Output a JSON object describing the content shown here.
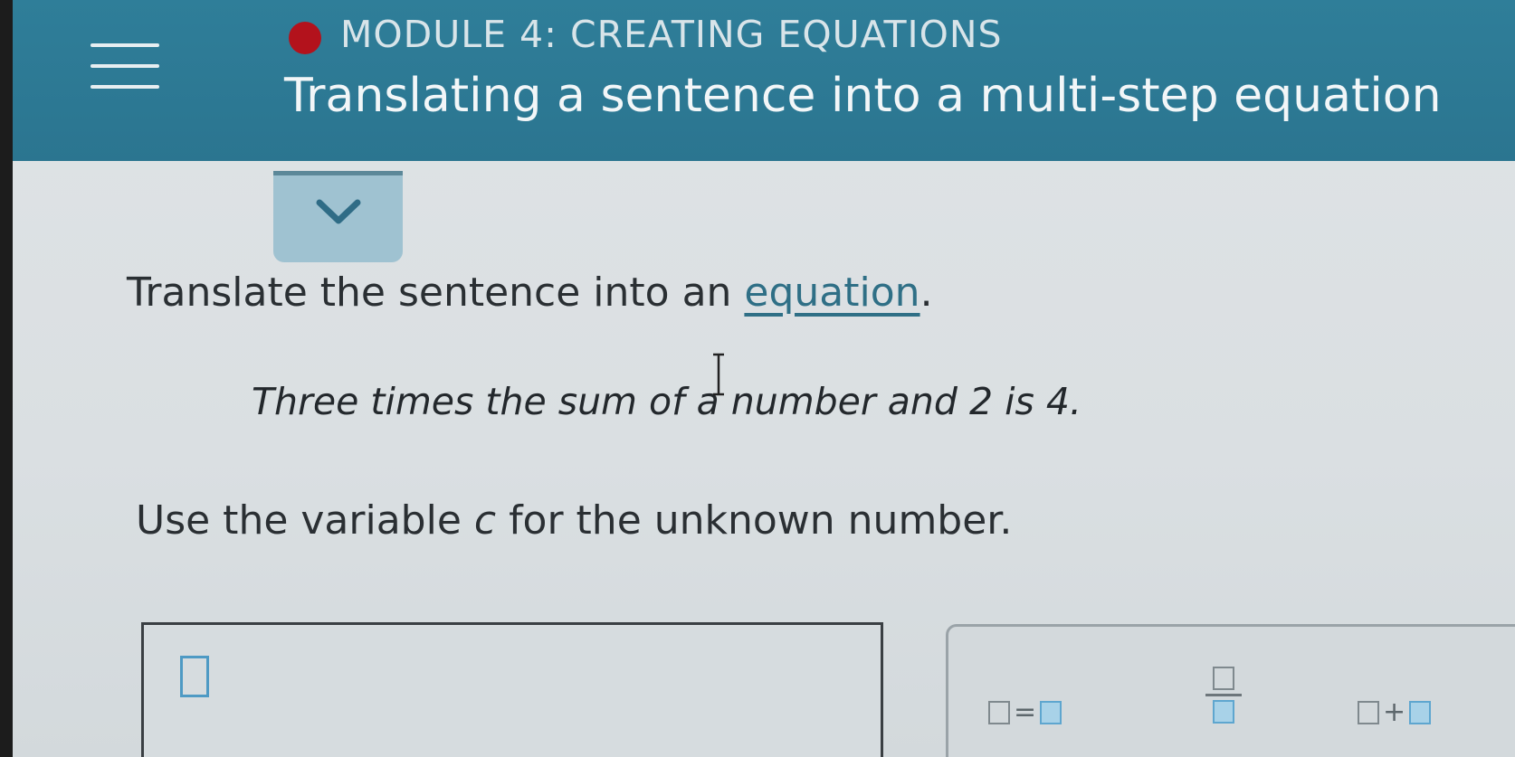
{
  "header": {
    "module_label": "MODULE 4: CREATING EQUATIONS",
    "topic_title": "Translating a sentence into a multi-step equation",
    "menu_icon": "hamburger-menu-icon",
    "status_color": "#b3121c",
    "bar_color": "#2f7e99"
  },
  "collapse": {
    "icon": "chevron-down-icon"
  },
  "problem": {
    "instruction_prefix": "Translate the sentence into an ",
    "instruction_link": "equation",
    "instruction_suffix": ".",
    "sentence": "Three times the sum of a number and 2 is 4.",
    "variable_prefix": "Use the variable ",
    "variable_name": "c",
    "variable_suffix": " for the unknown number."
  },
  "keypad": {
    "equals_symbol": "=",
    "plus_symbol": "+",
    "keys": [
      "equals-template",
      "fraction-template",
      "plus-template"
    ]
  }
}
